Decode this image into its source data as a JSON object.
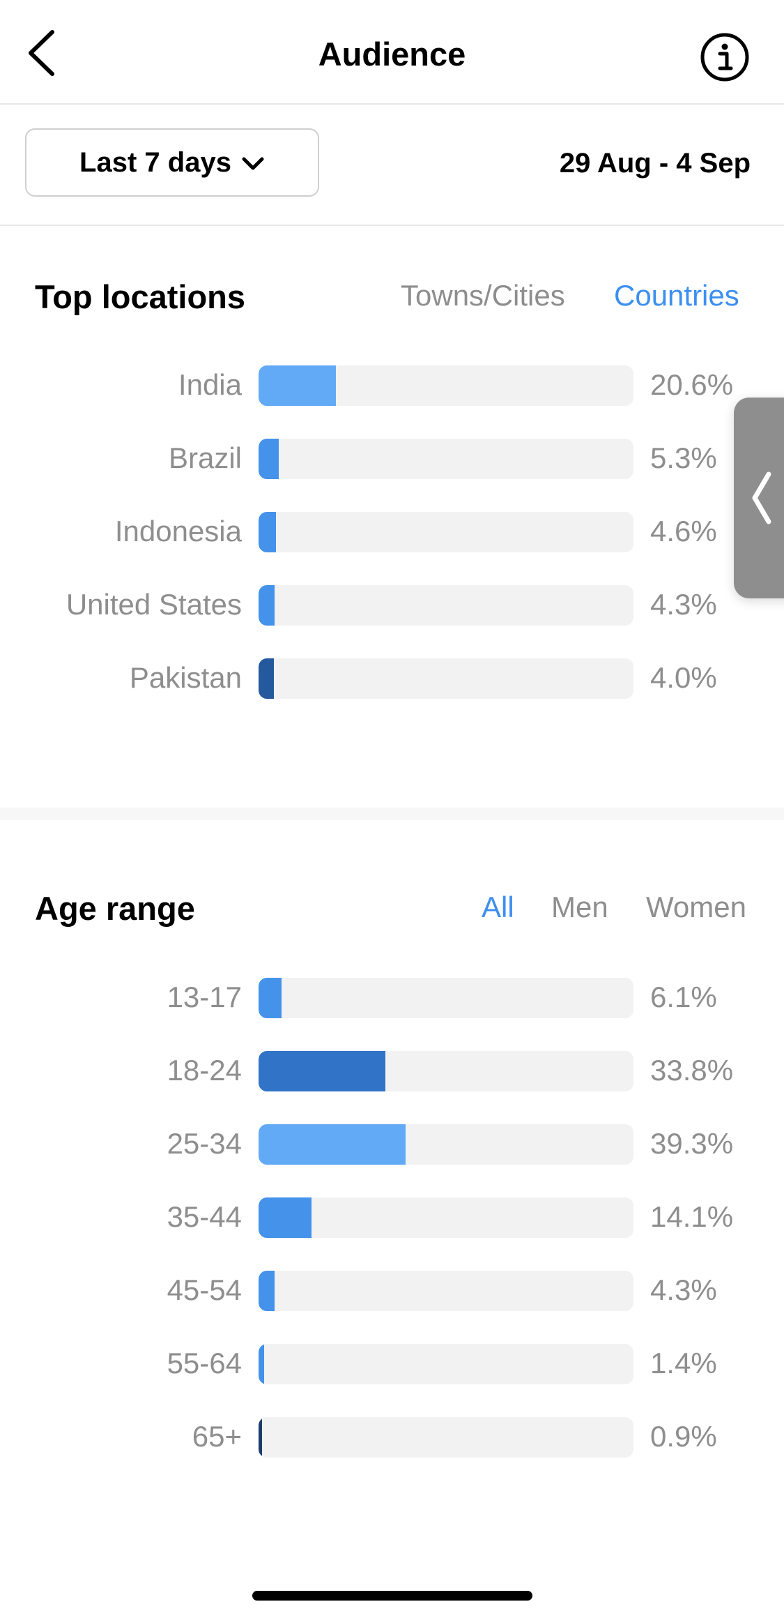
{
  "header": {
    "title": "Audience",
    "back_icon": "chevron-left-icon",
    "info_icon": "info-icon"
  },
  "filter": {
    "range_label": "Last 7 days",
    "dropdown_icon": "chevron-down-icon",
    "date_range": "29 Aug - 4 Sep"
  },
  "top_locations": {
    "title": "Top locations",
    "tabs": [
      {
        "label": "Towns/Cities",
        "active": false
      },
      {
        "label": "Countries",
        "active": true
      }
    ],
    "rows": [
      {
        "label": "India",
        "value": 20.6,
        "display": "20.6%",
        "color": "#63aaf6"
      },
      {
        "label": "Brazil",
        "value": 5.3,
        "display": "5.3%",
        "color": "#4592ea"
      },
      {
        "label": "Indonesia",
        "value": 4.6,
        "display": "4.6%",
        "color": "#4592ea"
      },
      {
        "label": "United States",
        "value": 4.3,
        "display": "4.3%",
        "color": "#4592ea"
      },
      {
        "label": "Pakistan",
        "value": 4.0,
        "display": "4.0%",
        "color": "#25599e"
      }
    ]
  },
  "age_range": {
    "title": "Age range",
    "tabs": [
      {
        "label": "All",
        "active": true
      },
      {
        "label": "Men",
        "active": false
      },
      {
        "label": "Women",
        "active": false
      }
    ],
    "rows": [
      {
        "label": "13-17",
        "value": 6.1,
        "display": "6.1%",
        "color": "#4592ea"
      },
      {
        "label": "18-24",
        "value": 33.8,
        "display": "33.8%",
        "color": "#3173c6"
      },
      {
        "label": "25-34",
        "value": 39.3,
        "display": "39.3%",
        "color": "#63aaf6"
      },
      {
        "label": "35-44",
        "value": 14.1,
        "display": "14.1%",
        "color": "#4592ea"
      },
      {
        "label": "45-54",
        "value": 4.3,
        "display": "4.3%",
        "color": "#4592ea"
      },
      {
        "label": "55-64",
        "value": 1.4,
        "display": "1.4%",
        "color": "#4592ea"
      },
      {
        "label": "65+",
        "value": 0.9,
        "display": "0.9%",
        "color": "#1b3d6e"
      }
    ]
  },
  "side_handle": {
    "icon": "chevron-left-icon"
  }
}
